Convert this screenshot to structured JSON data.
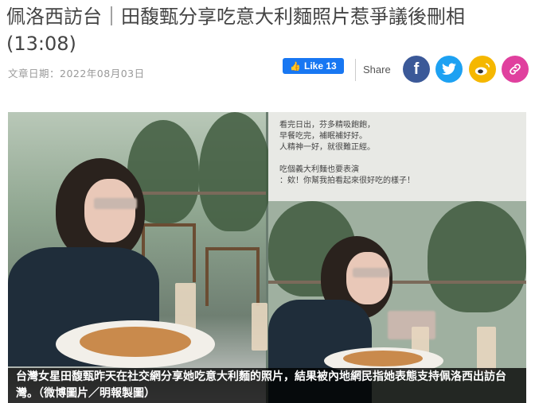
{
  "article": {
    "headline": "佩洛西訪台｜田馥甄分享吃意大利麵照片惹爭議後刪相 (13:08)",
    "date": "文章日期：2022年08月03日"
  },
  "social": {
    "like_label": "Like 13",
    "share_label": "Share",
    "facebook_glyph": "f",
    "buttons": [
      "facebook-icon",
      "twitter-icon",
      "weibo-icon",
      "link-icon"
    ]
  },
  "photo": {
    "post_lines": [
      "看完日出，芬多精吸飽飽，",
      "早餐吃完，補眠補好好。",
      "人精神一好，就很難正經。",
      "",
      "吃個義大利麵也要表演",
      "：欸！你幫我拍看起來很好吃的樣子！"
    ],
    "caption": "台灣女星田馥甄昨天在社交網分享她吃意大利麵的照片，結果被內地網民指她表態支持佩洛西出訪台灣。（微博圖片／明報製圖）"
  },
  "colors": {
    "facebook": "#3b5998",
    "twitter": "#1da1f2",
    "weibo": "#f5b700",
    "link": "#e0409e",
    "like_button": "#1877f2"
  }
}
